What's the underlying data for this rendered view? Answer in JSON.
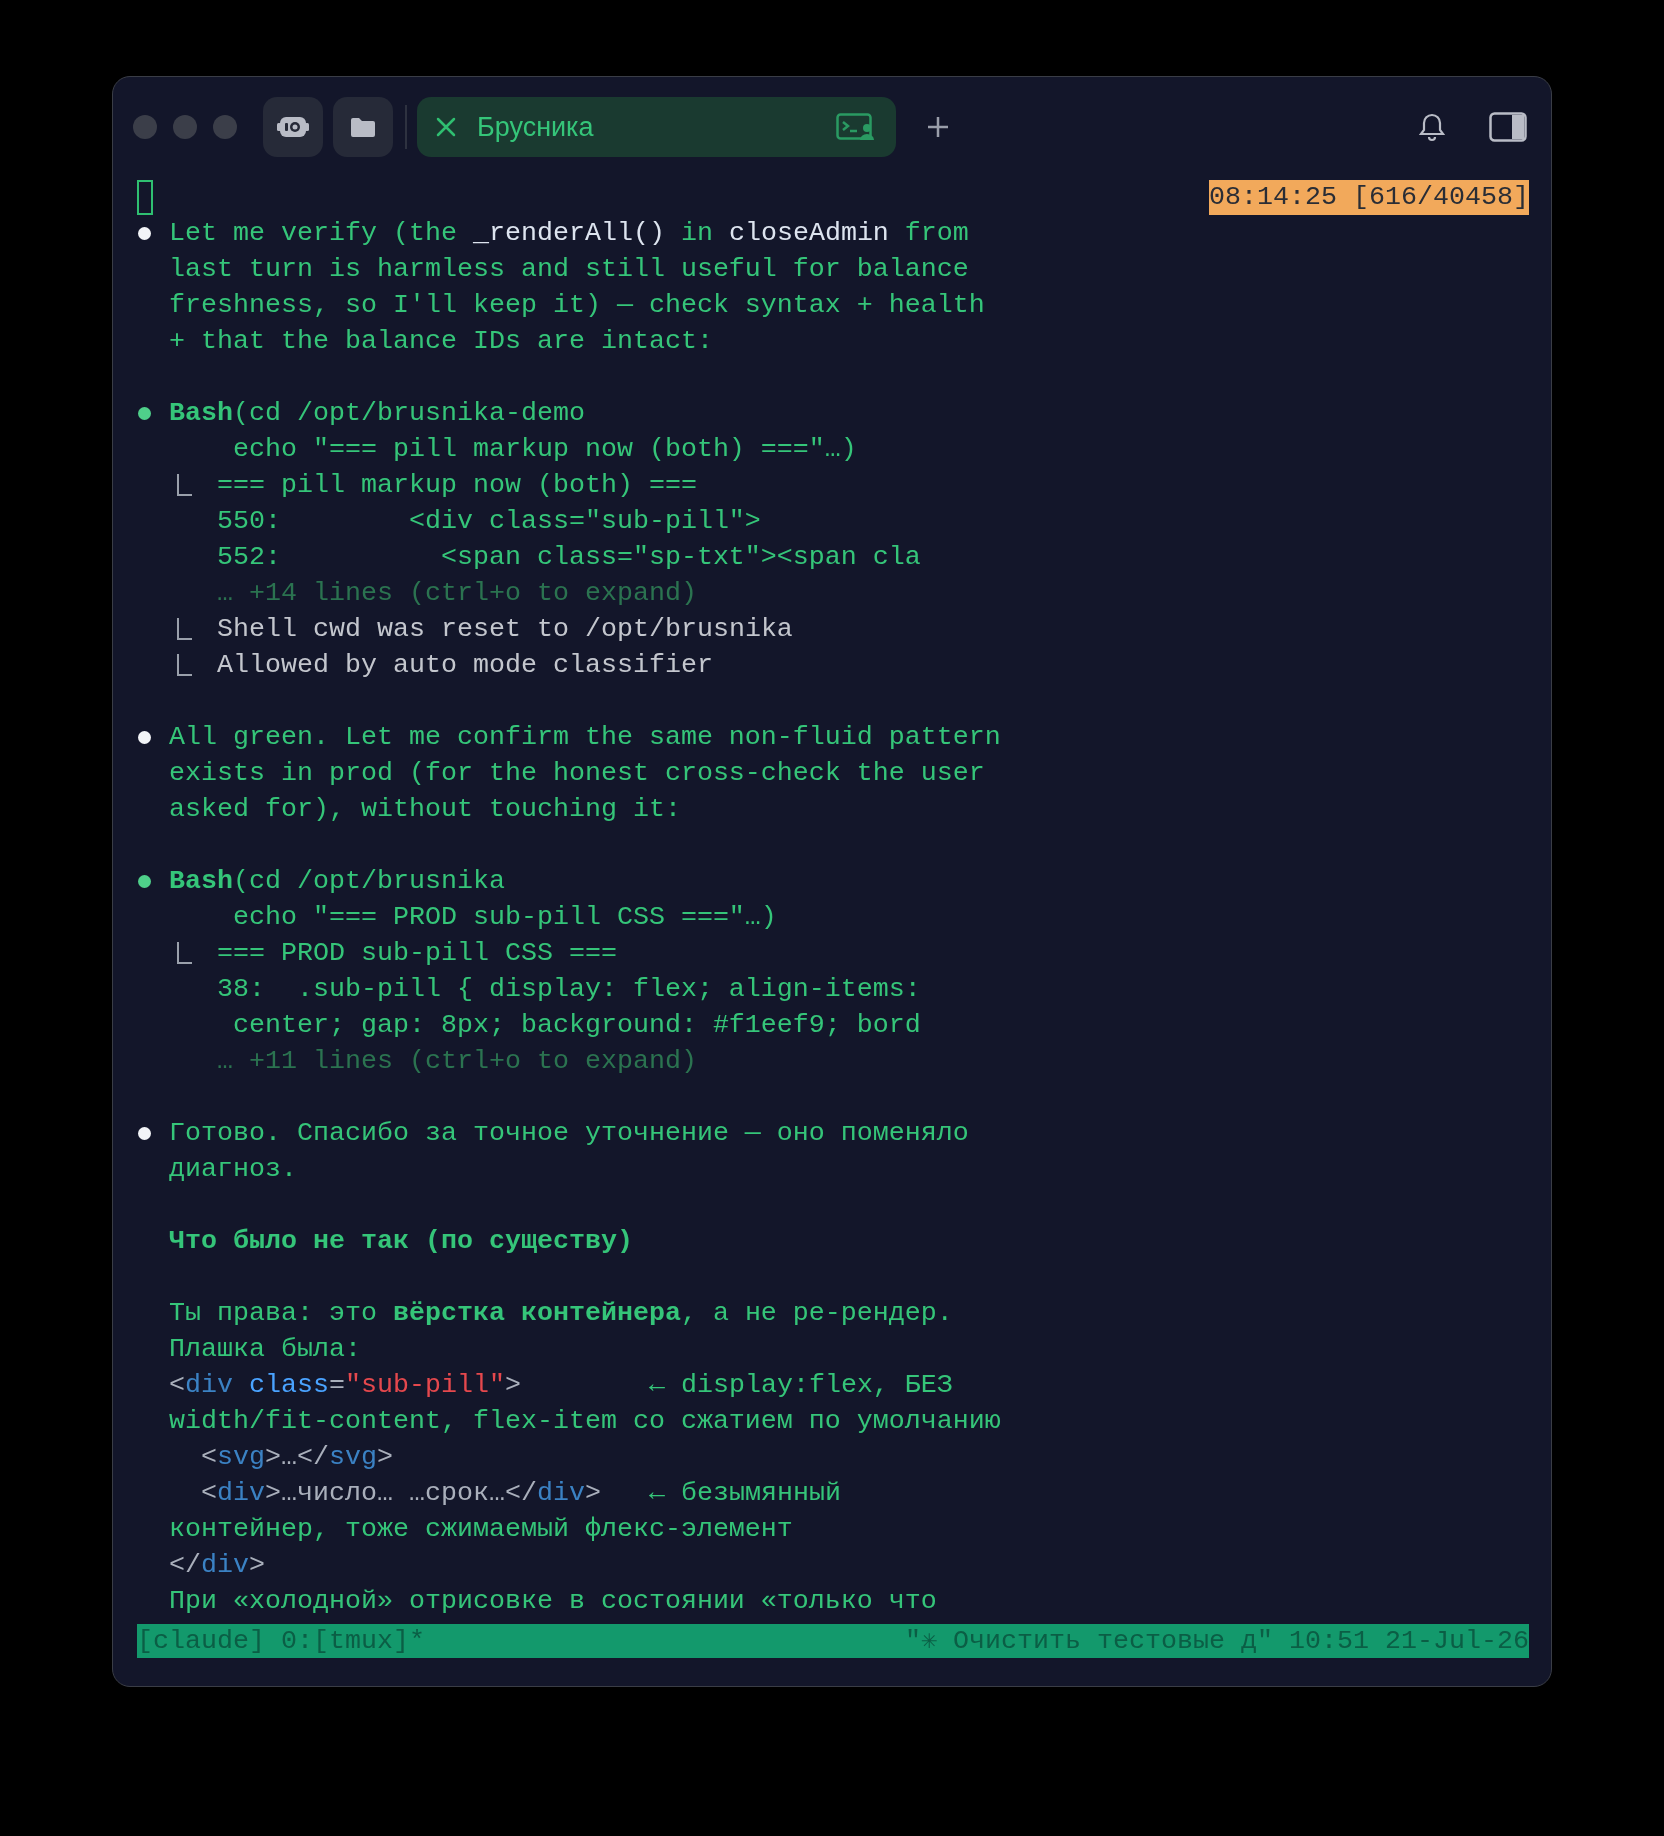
{
  "tab": {
    "title": "Брусника",
    "selected": true
  },
  "timestamp": "08:14:25 [616/40458]",
  "lines": [
    {
      "kind": "message",
      "segments": [
        {
          "text": "Let me verify (the ",
          "kind": "plain"
        },
        {
          "text": "_renderAll()",
          "kind": "ident"
        },
        {
          "text": " in ",
          "kind": "plain"
        },
        {
          "text": "closeAdmin",
          "kind": "ident"
        },
        {
          "text": " from",
          "kind": "plain"
        }
      ]
    },
    {
      "kind": "cont",
      "segments": [
        {
          "text": "last turn is harmless and still useful for balance",
          "kind": "plain"
        }
      ]
    },
    {
      "kind": "cont",
      "segments": [
        {
          "text": "freshness, so I'll keep it) — check syntax + health",
          "kind": "plain"
        }
      ]
    },
    {
      "kind": "cont",
      "segments": [
        {
          "text": "+ that the balance IDs are intact:",
          "kind": "plain"
        }
      ]
    },
    {
      "kind": "blank"
    },
    {
      "kind": "tool",
      "segments": [
        {
          "text": "Bash",
          "kind": "bold"
        },
        {
          "text": "(cd /opt/brusnika-demo",
          "kind": "plain"
        }
      ]
    },
    {
      "kind": "cont",
      "segments": [
        {
          "text": "    echo \"=== pill markup now (both) ===\"…)",
          "kind": "plain"
        }
      ]
    },
    {
      "kind": "result",
      "segments": [
        {
          "text": "=== pill markup now (both) ===",
          "kind": "plain"
        }
      ]
    },
    {
      "kind": "cont",
      "segments": [
        {
          "text": "   550:        <div class=\"sub-pill\">",
          "kind": "plain"
        }
      ]
    },
    {
      "kind": "cont",
      "segments": [
        {
          "text": "   552:          <span class=\"sp-txt\"><span cla",
          "kind": "plain"
        }
      ]
    },
    {
      "kind": "cont",
      "segments": [
        {
          "text": "   … +14 lines (ctrl+o to expand)",
          "kind": "dim"
        }
      ]
    },
    {
      "kind": "result",
      "segments": [
        {
          "text": "Shell cwd was reset to /opt/brusnika",
          "kind": "gray"
        }
      ]
    },
    {
      "kind": "result",
      "segments": [
        {
          "text": "Allowed by auto mode classifier",
          "kind": "gray"
        }
      ]
    },
    {
      "kind": "blank"
    },
    {
      "kind": "message",
      "segments": [
        {
          "text": "All green. Let me confirm the same non-fluid pattern",
          "kind": "plain"
        }
      ]
    },
    {
      "kind": "cont",
      "segments": [
        {
          "text": "exists in prod (for the honest cross-check the user",
          "kind": "plain"
        }
      ]
    },
    {
      "kind": "cont",
      "segments": [
        {
          "text": "asked for), without touching it:",
          "kind": "plain"
        }
      ]
    },
    {
      "kind": "blank"
    },
    {
      "kind": "tool",
      "segments": [
        {
          "text": "Bash",
          "kind": "bold"
        },
        {
          "text": "(cd /opt/brusnika",
          "kind": "plain"
        }
      ]
    },
    {
      "kind": "cont",
      "segments": [
        {
          "text": "    echo \"=== PROD sub-pill CSS ===\"…)",
          "kind": "plain"
        }
      ]
    },
    {
      "kind": "result",
      "segments": [
        {
          "text": "=== PROD sub-pill CSS ===",
          "kind": "plain"
        }
      ]
    },
    {
      "kind": "cont",
      "segments": [
        {
          "text": "   38:  .sub-pill { display: flex; align-items:",
          "kind": "plain"
        }
      ]
    },
    {
      "kind": "cont",
      "segments": [
        {
          "text": "    center; gap: 8px; background: #f1eef9; bord",
          "kind": "plain"
        }
      ]
    },
    {
      "kind": "cont",
      "segments": [
        {
          "text": "   … +11 lines (ctrl+o to expand)",
          "kind": "dim"
        }
      ]
    },
    {
      "kind": "blank"
    },
    {
      "kind": "message",
      "segments": [
        {
          "text": "Готово. Спасибо за точное уточнение — оно поменяло",
          "kind": "plain"
        }
      ]
    },
    {
      "kind": "cont",
      "segments": [
        {
          "text": "диагноз.",
          "kind": "plain"
        }
      ]
    },
    {
      "kind": "blank"
    },
    {
      "kind": "cont",
      "segments": [
        {
          "text": "Что было не так (по существу)",
          "kind": "bold"
        }
      ]
    },
    {
      "kind": "blank"
    },
    {
      "kind": "cont",
      "segments": [
        {
          "text": "Ты права: это ",
          "kind": "plain"
        },
        {
          "text": "вёрстка контейнера",
          "kind": "bold"
        },
        {
          "text": ", а не ре-рендер.",
          "kind": "plain"
        }
      ]
    },
    {
      "kind": "cont",
      "segments": [
        {
          "text": "Плашка была:",
          "kind": "plain"
        }
      ]
    },
    {
      "kind": "cont",
      "segments": [
        {
          "text": "<",
          "kind": "punct"
        },
        {
          "text": "div",
          "kind": "tag"
        },
        {
          "text": " class",
          "kind": "attr"
        },
        {
          "text": "=",
          "kind": "punct"
        },
        {
          "text": "\"sub-pill\"",
          "kind": "string"
        },
        {
          "text": ">",
          "kind": "punct"
        },
        {
          "text": "        ← display:flex, БЕЗ",
          "kind": "plain"
        }
      ]
    },
    {
      "kind": "cont",
      "segments": [
        {
          "text": "width/fit-content, flex-item со сжатием по умолчанию",
          "kind": "plain"
        }
      ]
    },
    {
      "kind": "cont",
      "segments": [
        {
          "text": "  <",
          "kind": "punct"
        },
        {
          "text": "svg",
          "kind": "tag"
        },
        {
          "text": ">…</",
          "kind": "punct"
        },
        {
          "text": "svg",
          "kind": "tag"
        },
        {
          "text": ">",
          "kind": "punct"
        }
      ]
    },
    {
      "kind": "cont",
      "segments": [
        {
          "text": "  <",
          "kind": "punct"
        },
        {
          "text": "div",
          "kind": "tag"
        },
        {
          "text": ">…число… …срок…</",
          "kind": "punct"
        },
        {
          "text": "div",
          "kind": "tag"
        },
        {
          "text": ">",
          "kind": "punct"
        },
        {
          "text": "   ← безымянный",
          "kind": "plain"
        }
      ]
    },
    {
      "kind": "cont",
      "segments": [
        {
          "text": "контейнер, тоже сжимаемый флекс-элемент",
          "kind": "plain"
        }
      ]
    },
    {
      "kind": "cont",
      "segments": [
        {
          "text": "</",
          "kind": "punct"
        },
        {
          "text": "div",
          "kind": "tag"
        },
        {
          "text": ">",
          "kind": "punct"
        }
      ]
    },
    {
      "kind": "cont",
      "segments": [
        {
          "text": "При «холодной» отрисовке в состоянии «только что",
          "kind": "plain"
        }
      ]
    }
  ],
  "status_bar": {
    "left": "[claude] 0:[tmux]*",
    "right": "\"✳ Очистить тестовые д\" 10:51 21-Jul-26"
  }
}
